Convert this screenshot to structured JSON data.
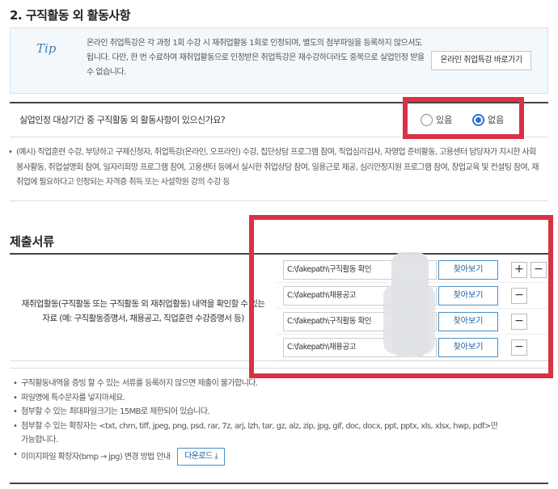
{
  "section": {
    "title": "2. 구직활동 외 활동사항"
  },
  "tip": {
    "label": "Tip",
    "text": "온라인 취업특강은 각 과정 1회 수강 시 재취업활동 1회로 인정되며, 별도의 첨부파일을 등록하지 않으셔도 됩니다. 다만, 한 번 수료하여 재취업활동으로 인정받은 취업특강은 재수강하더라도 중복으로 실업인정 받을 수 없습니다.",
    "button": "온라인 취업특강 바로가기"
  },
  "question": {
    "text": "실업인정 대상기간 중 구직활동 외 활동사항이 있으신가요?",
    "options": [
      {
        "label": "있음",
        "selected": false
      },
      {
        "label": "없음",
        "selected": true
      }
    ]
  },
  "example": {
    "bullet": "•",
    "text": "(예시) 직업훈련 수강, 부당하고 구제신청자, 취업특강(온라인, 오프라인) 수강, 집단상담 프로그램 참여, 직업심리검사, 자영업 준비활동, 고용센터 담당자가 지시한 사회봉사활동, 취업설명회 참여, 일자리희망 프로그램 참여, 고용센터 등에서 실시한 취업상담 참여, 일용근로 제공, 심리안정지원 프로그램 참여, 창업교육 및 컨설팅 참여, 재취업에 필요하다고 인정되는 자격증 취득 또는 사설학원 강의 수강 등"
  },
  "docs": {
    "title": "제출서류",
    "label_line1": "재취업활동(구직활동 또는 구직활동 외 재취업활동) 내역을 확인할 수 있는",
    "label_line2": "자료 (예: 구직활동증명서, 채용공고, 직업훈련 수강증명서 등)",
    "files": [
      {
        "path": "C:\\fakepath\\구직활동 확인",
        "button": "찾아보기"
      },
      {
        "path": "C:\\fakepath\\채용공고",
        "button": "찾아보기"
      },
      {
        "path": "C:\\fakepath\\구직활동 확인",
        "button": "찾아보기"
      },
      {
        "path": "C:\\fakepath\\채용공고",
        "button": "찾아보기"
      }
    ],
    "add_symbol": "+",
    "remove_symbol": "−"
  },
  "notes": {
    "items": [
      "구직활동내역을 증빙 할 수 있는 서류를 등록하지 않으면 제출이 불가합니다.",
      "파일명에 특수문자를 넣지마세요.",
      "첨부할 수 있는 최대파일크기는 15MB로 제한되어 있습니다.",
      "첨부할 수 있는 확장자는 <txt, chm, tiff, jpeg, png, psd, rar, 7z, arj, lzh, tar, gz, alz, zip, jpg, gif, doc, docx, ppt, pptx, xls, xlsx, hwp, pdf>만 가능합니다."
    ],
    "image_tip": "이미지파일 확장자(bmp → jpg) 변경 방법 안내",
    "download": "다운로드"
  },
  "colors": {
    "highlight": "#d93244",
    "accent": "#2b6fd6"
  }
}
